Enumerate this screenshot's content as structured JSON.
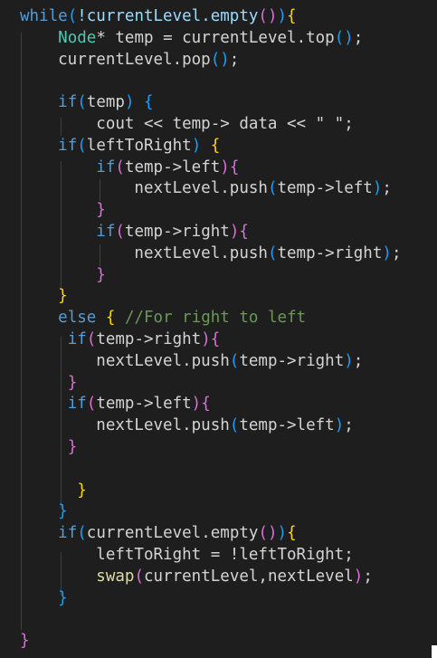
{
  "code_lines": [
    [
      {
        "t": "while",
        "c": "kw"
      },
      {
        "t": "(",
        "c": "b3"
      },
      {
        "t": "!currentLevel.empty",
        "c": "var"
      },
      {
        "t": "()",
        "c": "b2"
      },
      {
        "t": ")",
        "c": "b3"
      },
      {
        "t": "{",
        "c": "b1"
      }
    ],
    [
      {
        "t": "    "
      },
      {
        "t": "Node",
        "c": "type"
      },
      {
        "t": "* temp = currentLevel.top"
      },
      {
        "t": "()",
        "c": "b3"
      },
      {
        "t": ";"
      }
    ],
    [
      {
        "t": "    currentLevel.pop"
      },
      {
        "t": "()",
        "c": "b3"
      },
      {
        "t": ";"
      }
    ],
    [],
    [
      {
        "t": "    "
      },
      {
        "t": "if",
        "c": "kw"
      },
      {
        "t": "(",
        "c": "b3"
      },
      {
        "t": "temp"
      },
      {
        "t": ")",
        "c": "b3"
      },
      {
        "t": " "
      },
      {
        "t": "{",
        "c": "b3"
      }
    ],
    [
      {
        "t": "        cout << temp-> data << \" \";"
      }
    ],
    [
      {
        "t": "    "
      },
      {
        "t": "if",
        "c": "kw"
      },
      {
        "t": "(",
        "c": "b3"
      },
      {
        "t": "leftToRight"
      },
      {
        "t": ")",
        "c": "b3"
      },
      {
        "t": " "
      },
      {
        "t": "{",
        "c": "b1"
      }
    ],
    [
      {
        "t": "        "
      },
      {
        "t": "if",
        "c": "kw"
      },
      {
        "t": "(",
        "c": "b2"
      },
      {
        "t": "temp->left"
      },
      {
        "t": ")",
        "c": "b2"
      },
      {
        "t": "{",
        "c": "b2"
      }
    ],
    [
      {
        "t": "            nextLevel.push"
      },
      {
        "t": "(",
        "c": "b3"
      },
      {
        "t": "temp->left"
      },
      {
        "t": ")",
        "c": "b3"
      },
      {
        "t": ";"
      }
    ],
    [
      {
        "t": "        "
      },
      {
        "t": "}",
        "c": "b2"
      }
    ],
    [
      {
        "t": "        "
      },
      {
        "t": "if",
        "c": "kw"
      },
      {
        "t": "(",
        "c": "b2"
      },
      {
        "t": "temp->right"
      },
      {
        "t": ")",
        "c": "b2"
      },
      {
        "t": "{",
        "c": "b2"
      }
    ],
    [
      {
        "t": "            nextLevel.push"
      },
      {
        "t": "(",
        "c": "b3"
      },
      {
        "t": "temp->right"
      },
      {
        "t": ")",
        "c": "b3"
      },
      {
        "t": ";"
      }
    ],
    [
      {
        "t": "        "
      },
      {
        "t": "}",
        "c": "b2"
      }
    ],
    [
      {
        "t": "    "
      },
      {
        "t": "}",
        "c": "b1"
      }
    ],
    [
      {
        "t": "    "
      },
      {
        "t": "else",
        "c": "kw"
      },
      {
        "t": " "
      },
      {
        "t": "{",
        "c": "b1"
      },
      {
        "t": " "
      },
      {
        "t": "//For right to left",
        "c": "com"
      }
    ],
    [
      {
        "t": "     "
      },
      {
        "t": "if",
        "c": "kw"
      },
      {
        "t": "(",
        "c": "b2"
      },
      {
        "t": "temp->right"
      },
      {
        "t": ")",
        "c": "b2"
      },
      {
        "t": "{",
        "c": "b2"
      }
    ],
    [
      {
        "t": "        nextLevel.push"
      },
      {
        "t": "(",
        "c": "b3"
      },
      {
        "t": "temp->right"
      },
      {
        "t": ")",
        "c": "b3"
      },
      {
        "t": ";"
      }
    ],
    [
      {
        "t": "     "
      },
      {
        "t": "}",
        "c": "b2"
      }
    ],
    [
      {
        "t": "     "
      },
      {
        "t": "if",
        "c": "kw"
      },
      {
        "t": "(",
        "c": "b2"
      },
      {
        "t": "temp->left"
      },
      {
        "t": ")",
        "c": "b2"
      },
      {
        "t": "{",
        "c": "b2"
      }
    ],
    [
      {
        "t": "        nextLevel.push"
      },
      {
        "t": "(",
        "c": "b3"
      },
      {
        "t": "temp->left"
      },
      {
        "t": ")",
        "c": "b3"
      },
      {
        "t": ";"
      }
    ],
    [
      {
        "t": "     "
      },
      {
        "t": "}",
        "c": "b2"
      }
    ],
    [],
    [
      {
        "t": "      "
      },
      {
        "t": "}",
        "c": "b1"
      }
    ],
    [
      {
        "t": "    "
      },
      {
        "t": "}",
        "c": "b3"
      }
    ],
    [
      {
        "t": "    "
      },
      {
        "t": "if",
        "c": "kw"
      },
      {
        "t": "(",
        "c": "b3"
      },
      {
        "t": "currentLevel.empty"
      },
      {
        "t": "()",
        "c": "b2"
      },
      {
        "t": ")",
        "c": "b3"
      },
      {
        "t": "{",
        "c": "b1"
      }
    ],
    [
      {
        "t": "        leftToRight = !leftToRight;"
      }
    ],
    [
      {
        "t": "        "
      },
      {
        "t": "swap",
        "c": "fn"
      },
      {
        "t": "(",
        "c": "b2"
      },
      {
        "t": "currentLevel,nextLevel"
      },
      {
        "t": ")",
        "c": "b2"
      },
      {
        "t": ";"
      }
    ],
    [
      {
        "t": "    "
      },
      {
        "t": "}",
        "c": "b3"
      }
    ],
    [],
    [
      {
        "t": "}",
        "c": "b2"
      }
    ]
  ]
}
